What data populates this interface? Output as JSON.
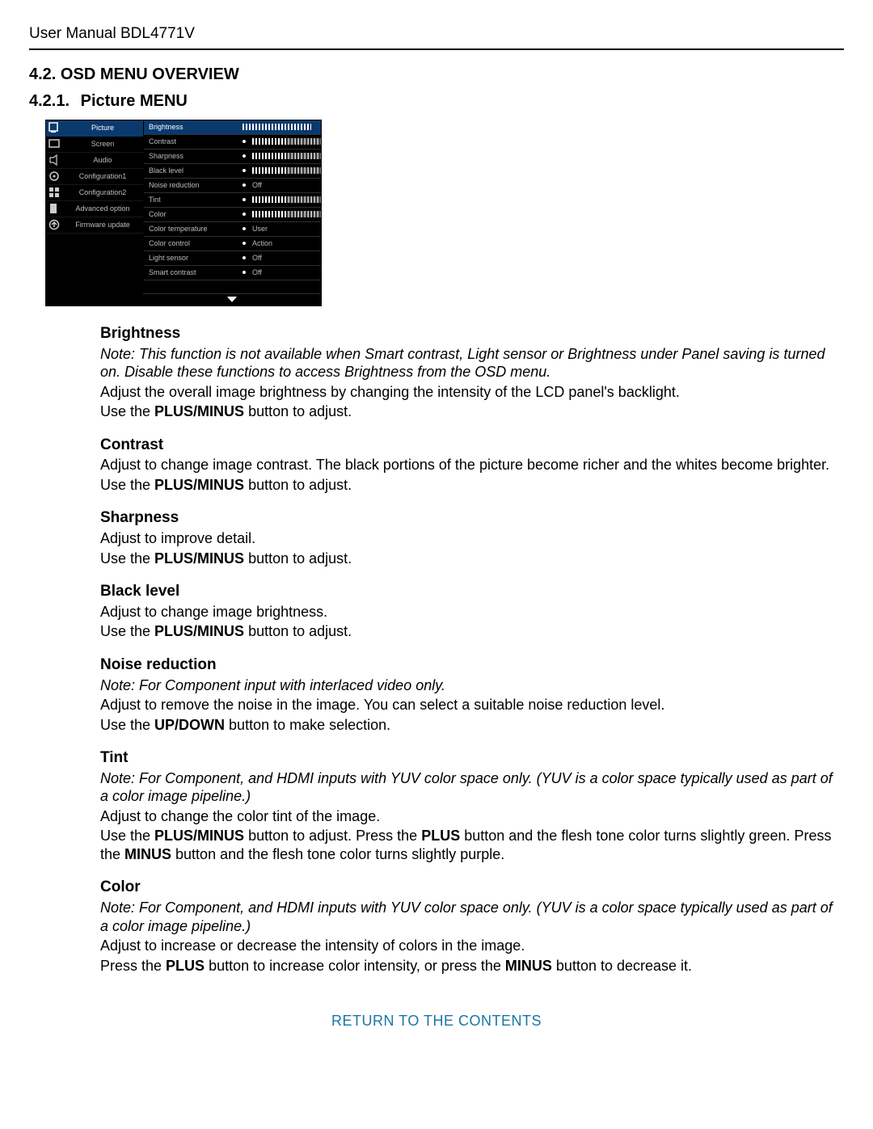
{
  "header": "User Manual BDL4771V",
  "section_num": "4.2.",
  "section_title": "OSD MENU OVERVIEW",
  "subsection_num": "4.2.1.",
  "subsection_title": "Picture MENU",
  "osd": {
    "sidebar": [
      {
        "label": "Picture",
        "active": true
      },
      {
        "label": "Screen",
        "active": false
      },
      {
        "label": "Audio",
        "active": false
      },
      {
        "label": "Configuration1",
        "active": false
      },
      {
        "label": "Configuration2",
        "active": false
      },
      {
        "label": "Advanced option",
        "active": false
      },
      {
        "label": "Firmware update",
        "active": false
      }
    ],
    "options": [
      {
        "label": "Brightness",
        "type": "slider",
        "active": true,
        "half": false
      },
      {
        "label": "Contrast",
        "type": "slider",
        "active": false,
        "half": true
      },
      {
        "label": "Sharpness",
        "type": "slider",
        "active": false,
        "half": true
      },
      {
        "label": "Black level",
        "type": "slider",
        "active": false,
        "half": true
      },
      {
        "label": "Noise reduction",
        "type": "value",
        "value": "Off"
      },
      {
        "label": "Tint",
        "type": "slider",
        "active": false,
        "half": true
      },
      {
        "label": "Color",
        "type": "slider",
        "active": false,
        "half": true
      },
      {
        "label": "Color temperature",
        "type": "value",
        "value": "User"
      },
      {
        "label": "Color control",
        "type": "value",
        "value": "Action"
      },
      {
        "label": "Light sensor",
        "type": "value",
        "value": "Off"
      },
      {
        "label": "Smart contrast",
        "type": "value",
        "value": "Off"
      }
    ]
  },
  "items": {
    "brightness": {
      "title": "Brightness",
      "note": "Note: This function is not available when Smart contrast, Light sensor or Brightness under Panel saving is turned on. Disable these functions to access Brightness from the OSD menu.",
      "p1": "Adjust the overall image brightness by changing the intensity of the LCD panel's backlight.",
      "p2a": "Use the ",
      "p2b": "PLUS/MINUS",
      "p2c": " button to adjust."
    },
    "contrast": {
      "title": "Contrast",
      "p1": "Adjust to change image contrast. The black portions of the picture become richer and the whites become brighter.",
      "p2a": "Use the ",
      "p2b": "PLUS/MINUS",
      "p2c": " button to adjust."
    },
    "sharpness": {
      "title": "Sharpness",
      "p1": "Adjust to improve detail.",
      "p2a": "Use the ",
      "p2b": "PLUS/MINUS",
      "p2c": " button to adjust."
    },
    "blacklevel": {
      "title": "Black level",
      "p1": "Adjust to change image brightness.",
      "p2a": "Use the ",
      "p2b": "PLUS/MINUS",
      "p2c": " button to adjust."
    },
    "noise": {
      "title": "Noise reduction",
      "note": "Note: For Component input with interlaced video only.",
      "p1": "Adjust to remove the noise in the image. You can select a suitable noise reduction level.",
      "p2a": "Use the ",
      "p2b": "UP/DOWN",
      "p2c": " button to make selection."
    },
    "tint": {
      "title": "Tint",
      "note": "Note: For Component, and HDMI inputs with YUV color space only. (YUV is a color space typically used as part of a color image pipeline.)",
      "p1": "Adjust to change the color tint of the image.",
      "p2a": "Use the ",
      "p2b": "PLUS/MINUS",
      "p2c": " button to adjust. Press the ",
      "p2d": "PLUS",
      "p2e": " button and the flesh tone color turns slightly green. Press the ",
      "p2f": "MINUS",
      "p2g": " button and the flesh tone color turns slightly purple."
    },
    "color": {
      "title": "Color",
      "note": "Note: For Component, and HDMI inputs with YUV color space only. (YUV is a color space typically used as part of a color image pipeline.)",
      "p1": "Adjust to increase or decrease the intensity of colors in the image.",
      "p2a": "Press the ",
      "p2b": "PLUS",
      "p2c": " button to increase color intensity, or press the ",
      "p2d": "MINUS",
      "p2e": " button to decrease it."
    }
  },
  "footer": "RETURN TO THE CONTENTS"
}
